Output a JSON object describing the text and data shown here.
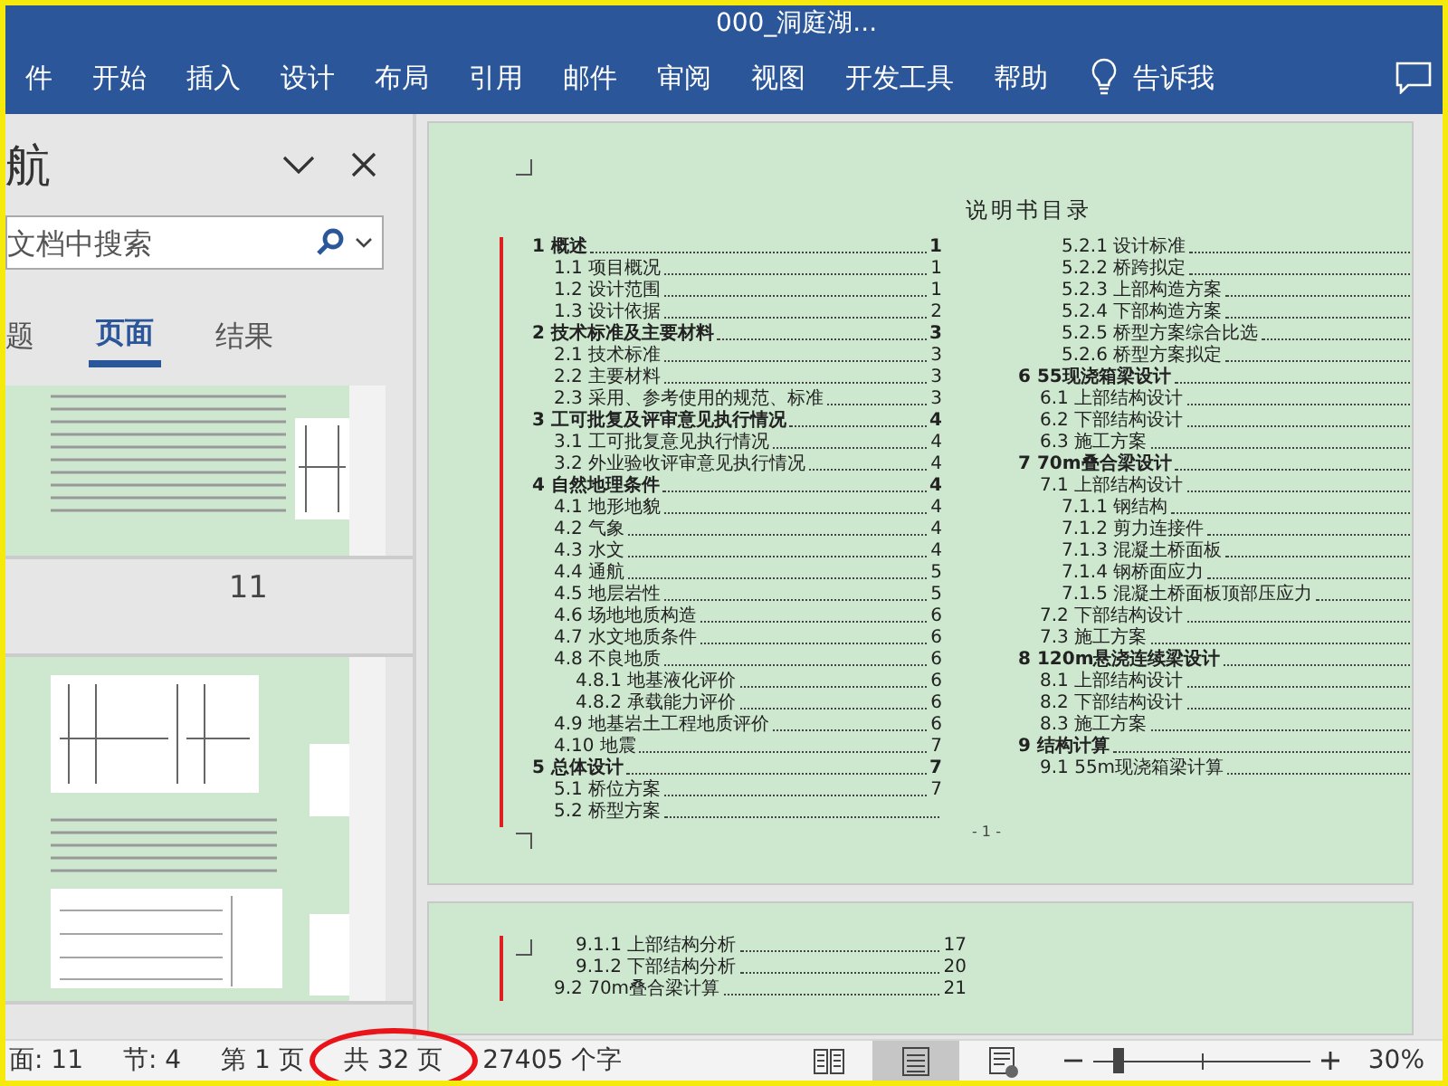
{
  "window": {
    "title": "000_洞庭湖..."
  },
  "ribbon": {
    "tabs": [
      {
        "label": "件",
        "selected": false
      },
      {
        "label": "开始",
        "selected": false
      },
      {
        "label": "插入",
        "selected": false
      },
      {
        "label": "设计",
        "selected": false
      },
      {
        "label": "布局",
        "selected": false
      },
      {
        "label": "引用",
        "selected": false
      },
      {
        "label": "邮件",
        "selected": false
      },
      {
        "label": "审阅",
        "selected": false
      },
      {
        "label": "视图",
        "selected": false
      },
      {
        "label": "开发工具",
        "selected": false
      },
      {
        "label": "帮助",
        "selected": false
      }
    ],
    "tell_me": "告诉我"
  },
  "navigation": {
    "title": "航",
    "search": {
      "placeholder": "文档中搜索"
    },
    "tabs": [
      {
        "label": "题",
        "selected": false
      },
      {
        "label": "页面",
        "selected": true
      },
      {
        "label": "结果",
        "selected": false
      }
    ],
    "thumbnails": [
      {
        "kind": "text_page"
      },
      {
        "kind": "number",
        "label": "11"
      },
      {
        "kind": "figure_page"
      }
    ]
  },
  "document": {
    "pages": [
      {
        "title": "说明书目录",
        "footer": "- 1 -",
        "toc": [
          {
            "label": "1 概述",
            "page": "1",
            "children": [
              {
                "label": "1.1 项目概况",
                "page": "1"
              },
              {
                "label": "1.2 设计范围",
                "page": "1"
              },
              {
                "label": "1.3 设计依据",
                "page": "2"
              }
            ]
          },
          {
            "label": "2 技术标准及主要材料",
            "page": "3",
            "children": [
              {
                "label": "2.1 技术标准",
                "page": "3"
              },
              {
                "label": "2.2 主要材料",
                "page": "3"
              },
              {
                "label": "2.3 采用、参考使用的规范、标准",
                "page": "3"
              }
            ]
          },
          {
            "label": "3 工可批复及评审意见执行情况",
            "page": "4",
            "children": [
              {
                "label": "3.1 工可批复意见执行情况",
                "page": "4"
              },
              {
                "label": "3.2 外业验收评审意见执行情况",
                "page": "4"
              }
            ]
          },
          {
            "label": "4 自然地理条件",
            "page": "4",
            "children": [
              {
                "label": "4.1 地形地貌",
                "page": "4"
              },
              {
                "label": "4.2 气象",
                "page": "4"
              },
              {
                "label": "4.3 水文",
                "page": "4"
              },
              {
                "label": "4.4 通航",
                "page": "5"
              },
              {
                "label": "4.5 地层岩性",
                "page": "5"
              },
              {
                "label": "4.6 场地地质构造",
                "page": "6"
              },
              {
                "label": "4.7 水文地质条件",
                "page": "6"
              },
              {
                "label": "4.8 不良地质",
                "page": "6",
                "children": [
                  {
                    "label": "4.8.1 地基液化评价",
                    "page": "6"
                  },
                  {
                    "label": "4.8.2 承载能力评价",
                    "page": "6"
                  }
                ]
              },
              {
                "label": "4.9 地基岩土工程地质评价",
                "page": "6"
              },
              {
                "label": "4.10 地震",
                "page": "7"
              }
            ]
          },
          {
            "label": "5 总体设计",
            "page": "7",
            "children": [
              {
                "label": "5.1 桥位方案",
                "page": "7"
              },
              {
                "label": "5.2 桥型方案",
                "children": [
                  {
                    "label": "5.2.1 设计标准"
                  },
                  {
                    "label": "5.2.2 桥跨拟定"
                  },
                  {
                    "label": "5.2.3 上部构造方案"
                  },
                  {
                    "label": "5.2.4 下部构造方案"
                  },
                  {
                    "label": "5.2.5 桥型方案综合比选"
                  },
                  {
                    "label": "5.2.6 桥型方案拟定"
                  }
                ]
              }
            ]
          },
          {
            "label": "6 55现浇箱梁设计",
            "children": [
              {
                "label": "6.1 上部结构设计"
              },
              {
                "label": "6.2 下部结构设计"
              },
              {
                "label": "6.3 施工方案"
              }
            ]
          },
          {
            "label": "7 70m叠合梁设计",
            "children": [
              {
                "label": "7.1 上部结构设计",
                "children": [
                  {
                    "label": "7.1.1 钢结构"
                  },
                  {
                    "label": "7.1.2 剪力连接件"
                  },
                  {
                    "label": "7.1.3 混凝土桥面板"
                  },
                  {
                    "label": "7.1.4 钢桥面应力"
                  },
                  {
                    "label": "7.1.5 混凝土桥面板顶部压应力"
                  }
                ]
              },
              {
                "label": "7.2 下部结构设计"
              },
              {
                "label": "7.3 施工方案"
              }
            ]
          },
          {
            "label": "8 120m悬浇连续梁设计",
            "children": [
              {
                "label": "8.1 上部结构设计"
              },
              {
                "label": "8.2 下部结构设计"
              },
              {
                "label": "8.3 施工方案"
              }
            ]
          },
          {
            "label": "9 结构计算",
            "children": [
              {
                "label": "9.1 55m现浇箱梁计算"
              }
            ]
          }
        ]
      },
      {
        "entries": [
          {
            "kind": "subsubsection",
            "label": "9.1.1 上部结构分析",
            "page": "17"
          },
          {
            "kind": "subsubsection",
            "label": "9.1.2 下部结构分析",
            "page": "20"
          },
          {
            "kind": "subsection",
            "label": "9.2 70m叠合梁计算",
            "page": "21"
          }
        ]
      }
    ]
  },
  "status_bar": {
    "items": [
      {
        "text": "面: 11",
        "highlighted": false
      },
      {
        "text": "节: 4",
        "highlighted": false
      },
      {
        "text": "第 1 页",
        "highlighted": false
      },
      {
        "text": "共 32 页",
        "highlighted": true
      },
      {
        "text": "27405 个字",
        "highlighted": false
      }
    ],
    "views": [
      {
        "kind": "read",
        "selected": false
      },
      {
        "kind": "print",
        "selected": true
      },
      {
        "kind": "web",
        "selected": false
      }
    ],
    "zoom": {
      "level": 0.12,
      "reading": "30%"
    }
  }
}
